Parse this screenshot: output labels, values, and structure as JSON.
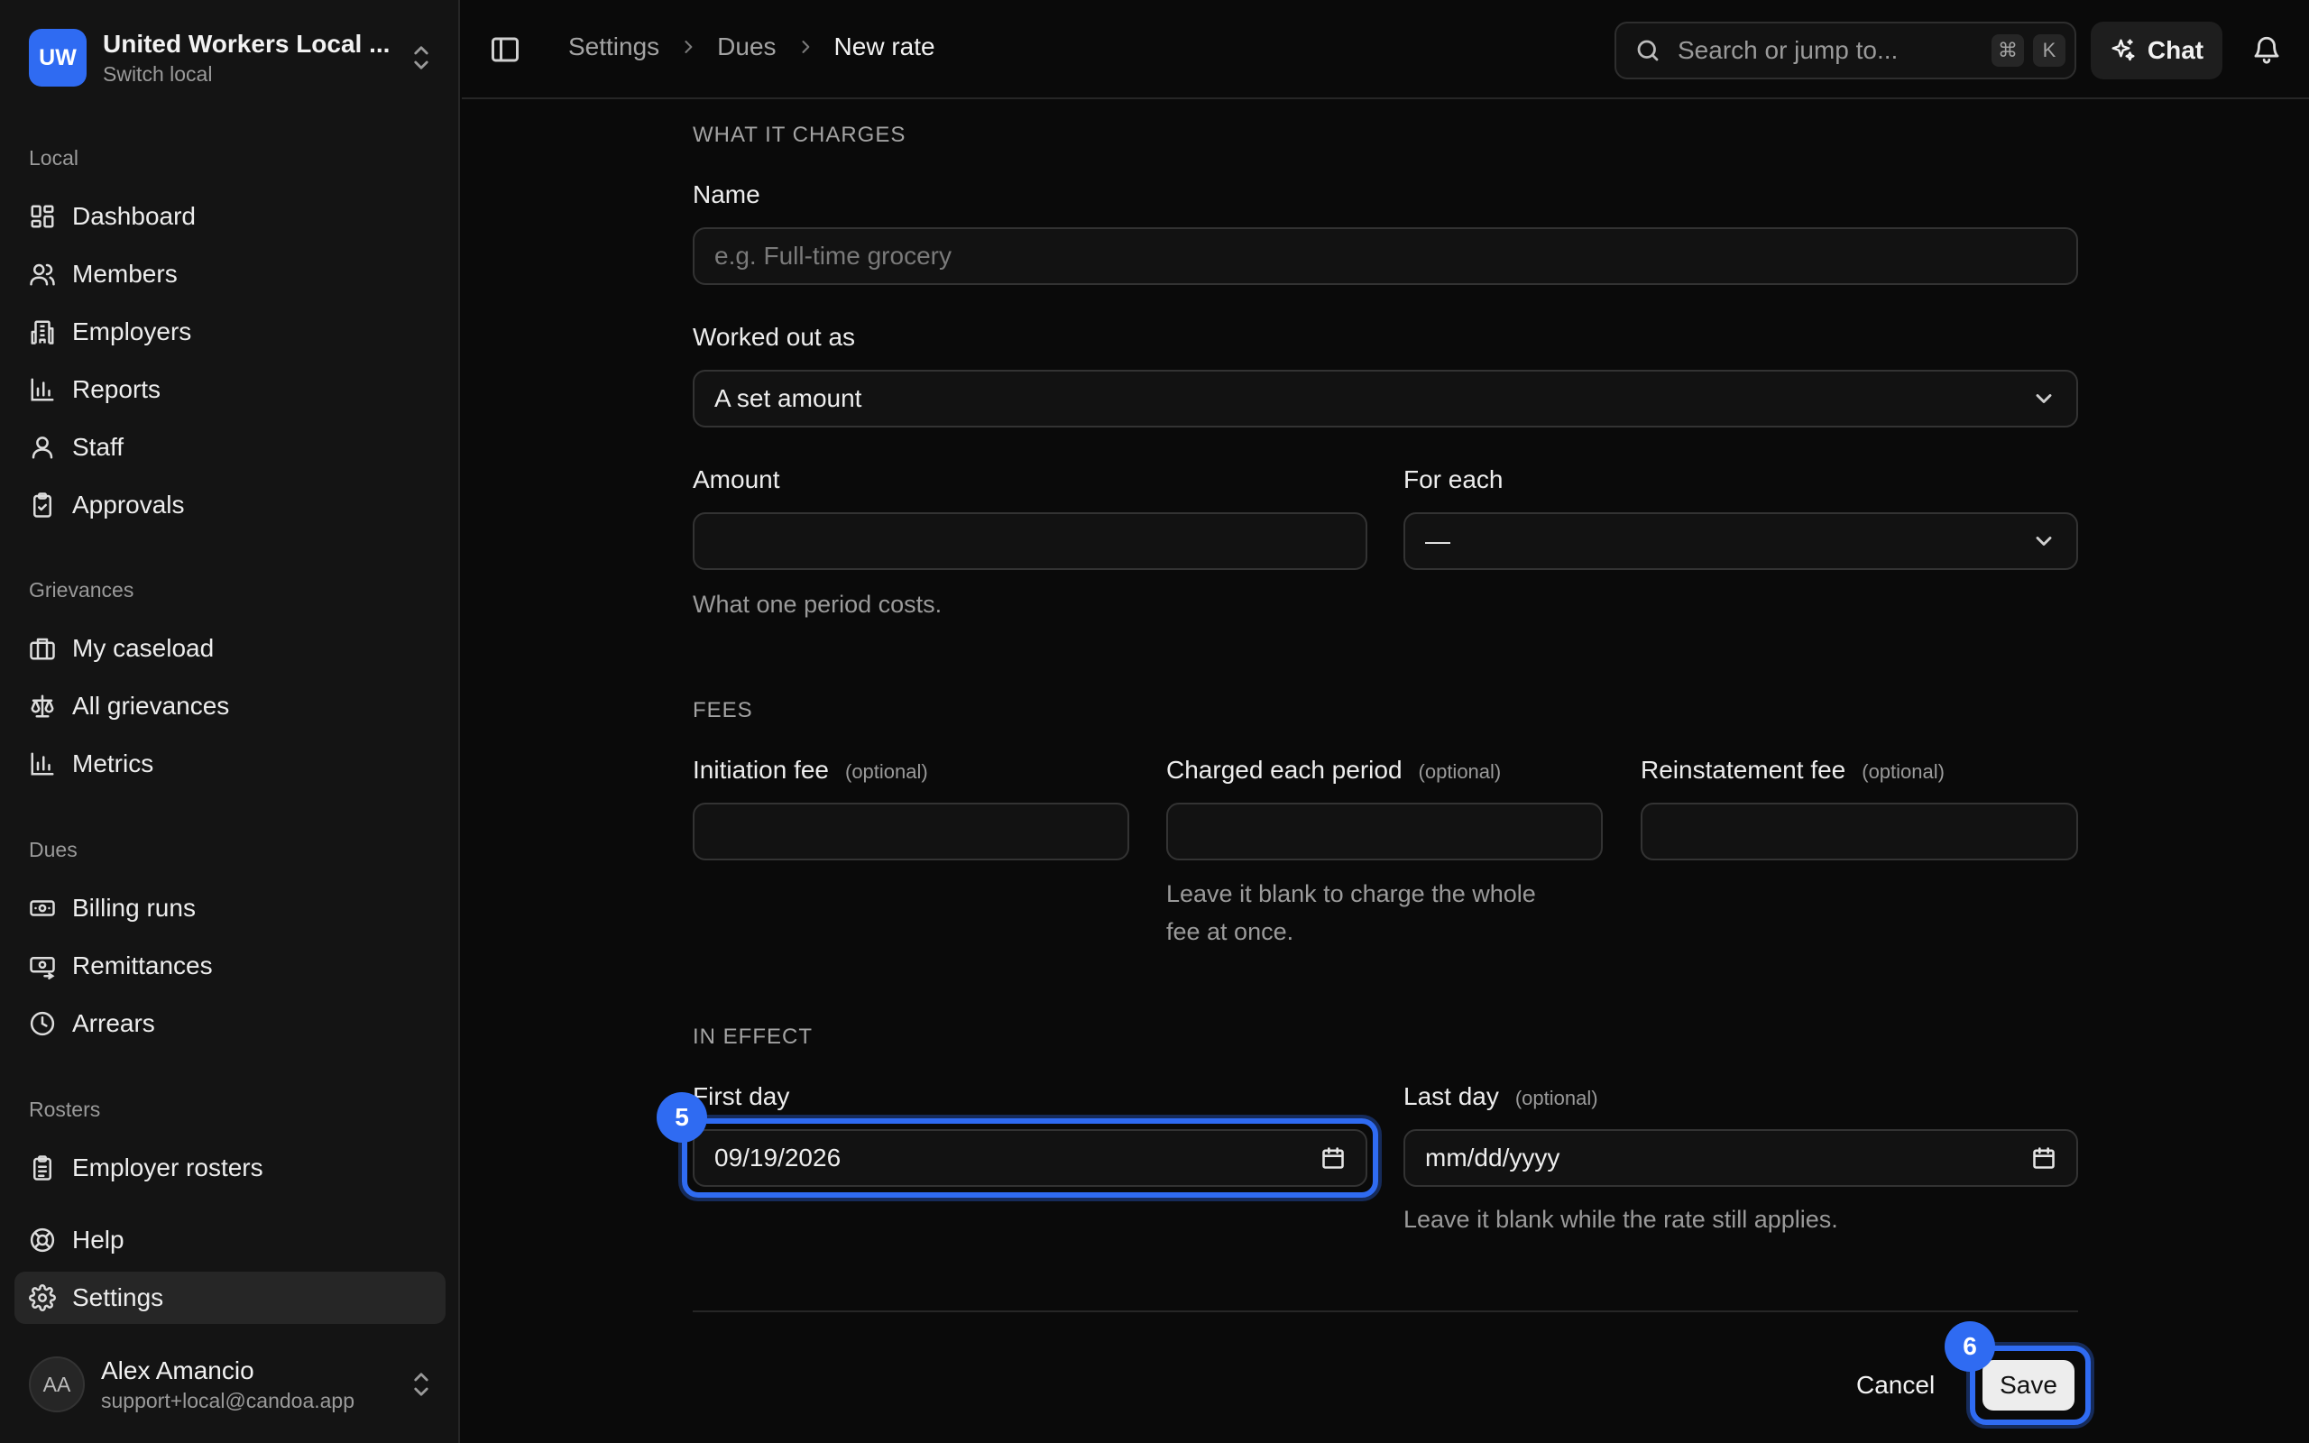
{
  "org": {
    "initials": "UW",
    "name": "United Workers Local ...",
    "switch_label": "Switch local"
  },
  "sidebar": {
    "sections": {
      "local": "Local",
      "grievances": "Grievances",
      "dues": "Dues",
      "rosters": "Rosters"
    },
    "items": {
      "dashboard": "Dashboard",
      "members": "Members",
      "employers": "Employers",
      "reports": "Reports",
      "staff": "Staff",
      "approvals": "Approvals",
      "my_caseload": "My caseload",
      "all_grievances": "All grievances",
      "metrics": "Metrics",
      "billing_runs": "Billing runs",
      "remittances": "Remittances",
      "arrears": "Arrears",
      "employer_rosters": "Employer rosters",
      "help": "Help",
      "settings": "Settings"
    },
    "active": "settings"
  },
  "user": {
    "initials": "AA",
    "name": "Alex Amancio",
    "email": "support+local@candoa.app"
  },
  "breadcrumb": {
    "items": [
      "Settings",
      "Dues"
    ],
    "current": "New rate"
  },
  "search": {
    "placeholder": "Search or jump to...",
    "shortcut_mod": "⌘",
    "shortcut_key": "K"
  },
  "chat": {
    "label": "Chat"
  },
  "form": {
    "what_it_charges": {
      "title": "WHAT IT CHARGES",
      "name_label": "Name",
      "name_placeholder": "e.g. Full-time grocery",
      "worked_out_label": "Worked out as",
      "worked_out_value": "A set amount",
      "amount_label": "Amount",
      "amount_value": "",
      "for_each_label": "For each",
      "for_each_value": "—",
      "amount_help": "What one period costs."
    },
    "fees": {
      "title": "FEES",
      "optional": "(optional)",
      "initiation_label": "Initiation fee",
      "charged_label": "Charged each period",
      "reinstatement_label": "Reinstatement fee",
      "charged_help_1": "Leave it blank to charge the whole",
      "charged_help_2": "fee at once."
    },
    "in_effect": {
      "title": "IN EFFECT",
      "first_day_label": "First day",
      "first_day_value": "09/19/2026",
      "last_day_label": "Last day",
      "last_day_placeholder": "mm/dd/yyyy",
      "last_day_help": "Leave it blank while the rate still applies."
    },
    "cancel_label": "Cancel",
    "save_label": "Save"
  },
  "annotations": {
    "first_day_step": "5",
    "save_step": "6"
  },
  "colors": {
    "accent": "#2f6bf2",
    "background": "#0a0a0a",
    "sidebar": "#141414"
  }
}
